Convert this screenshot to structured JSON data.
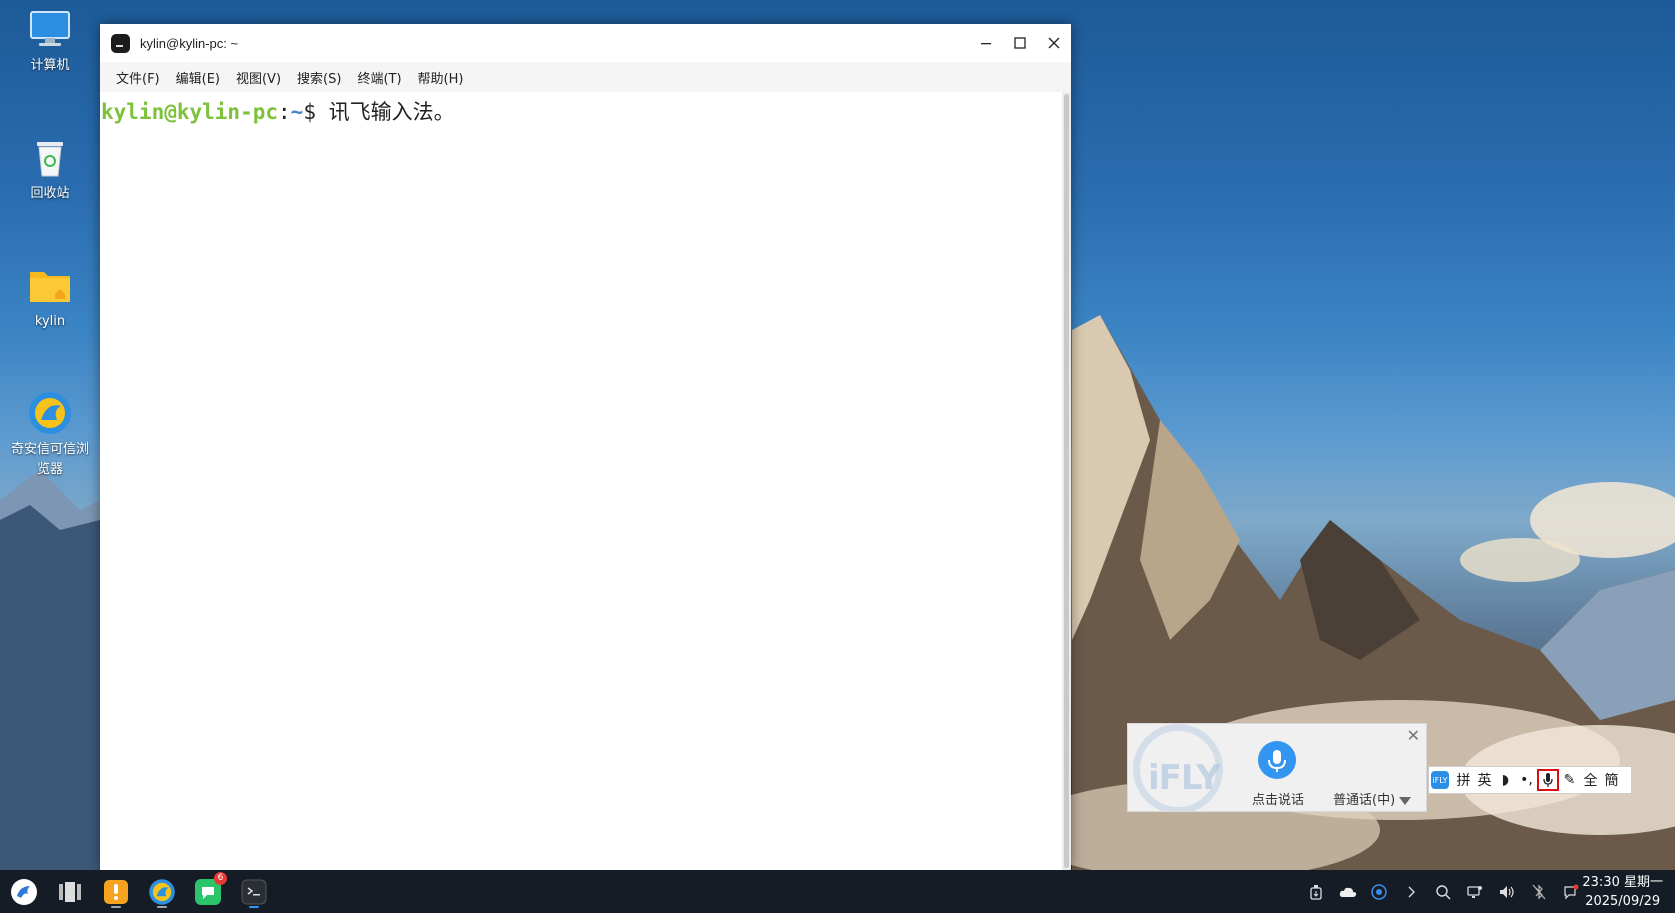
{
  "desktop": {
    "icons": [
      {
        "label": "计算机"
      },
      {
        "label": "回收站"
      },
      {
        "label": "kylin"
      },
      {
        "label": "奇安信可信浏览器"
      }
    ]
  },
  "window": {
    "title": "kylin@kylin-pc: ~",
    "menu": [
      "文件(F)",
      "编辑(E)",
      "视图(V)",
      "搜索(S)",
      "终端(T)",
      "帮助(H)"
    ]
  },
  "terminal": {
    "user_host": "kylin@kylin-pc",
    "colon": ":",
    "path": "~",
    "prompt": "$ ",
    "input": "讯飞输入法。"
  },
  "ifly": {
    "logo": "iFLY",
    "speak_label": "点击说话",
    "language": "普通话(中)",
    "close": "✕"
  },
  "ime_toolbar": {
    "badge": "iFLY",
    "items": [
      "拼",
      "英",
      "◗",
      "•,",
      "mic",
      "✎",
      "全",
      "簡"
    ]
  },
  "taskbar": {
    "badge_count": "6",
    "time": "23:30 星期一",
    "date": "2025/09/29"
  }
}
